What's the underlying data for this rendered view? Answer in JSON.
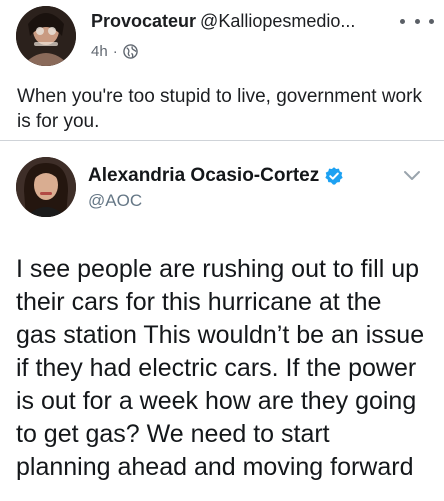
{
  "outer_post": {
    "author_name": "Provocateur",
    "author_handle": "@Kalliopesmedio...",
    "time": "4h",
    "separator": "·",
    "privacy_icon": "globe-icon",
    "more_icon": "more-horizontal-icon",
    "text": "When you're too stupid to live, government work is for you."
  },
  "tweet": {
    "author_name": "Alexandria Ocasio-Cortez",
    "verified_icon": "verified-badge-icon",
    "author_handle": "@AOC",
    "menu_icon": "chevron-down-icon",
    "text": "I see people are rushing out to fill up\ntheir cars for this hurricane at the\ngas station This wouldn’t be an issue\nif they had electric cars. If the power\nis out for a week how are they going\nto get gas? We need to start\nplanning ahead and moving forward"
  },
  "colors": {
    "verified_blue": "#1da1f2",
    "secondary_text": "#657786",
    "meta_text": "#606770",
    "divider": "#cfd3d8"
  }
}
